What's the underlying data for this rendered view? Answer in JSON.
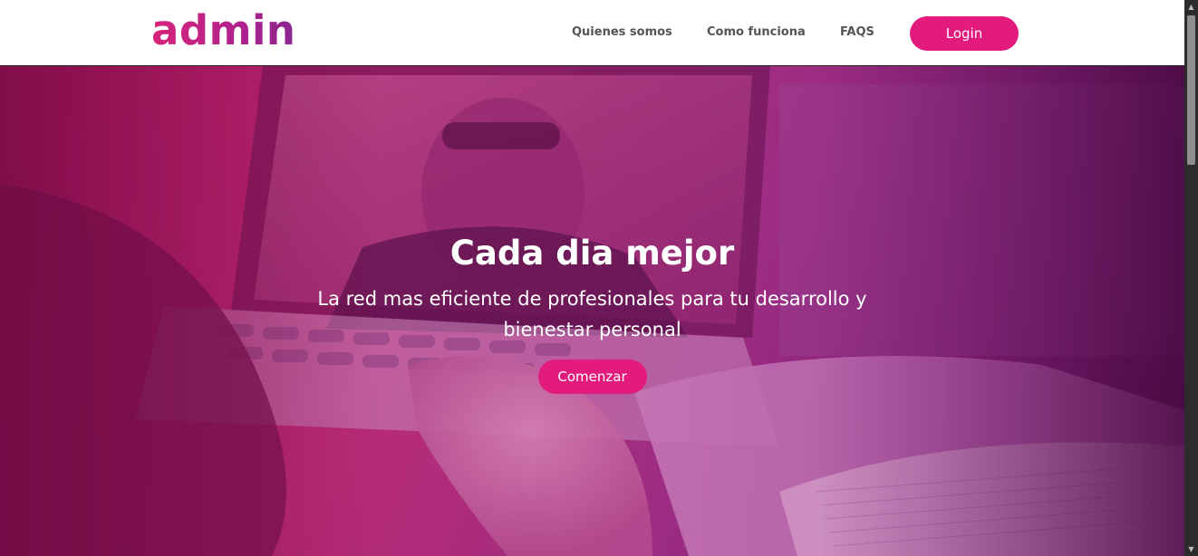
{
  "header": {
    "logo_text": "admin",
    "nav": [
      {
        "label": "Quienes somos"
      },
      {
        "label": "Como funciona"
      },
      {
        "label": "FAQS"
      }
    ],
    "login_label": "Login"
  },
  "hero": {
    "title": "Cada dia mejor",
    "subtitle": "La red mas eficiente de profesionales para tu desarrollo y bienestar personal",
    "cta_label": "Comenzar",
    "image": "blurred-person-at-laptop-with-open-book-magenta-tint"
  },
  "colors": {
    "accent": "#e31b7d",
    "logo_gradient_start": "#d8237b",
    "logo_gradient_end": "#8a2590",
    "nav_text": "#555555",
    "hero_tint": "#c8337f"
  },
  "scrollbar": {
    "up_icon": "triangle-up-icon",
    "down_icon": "triangle-down-icon"
  }
}
